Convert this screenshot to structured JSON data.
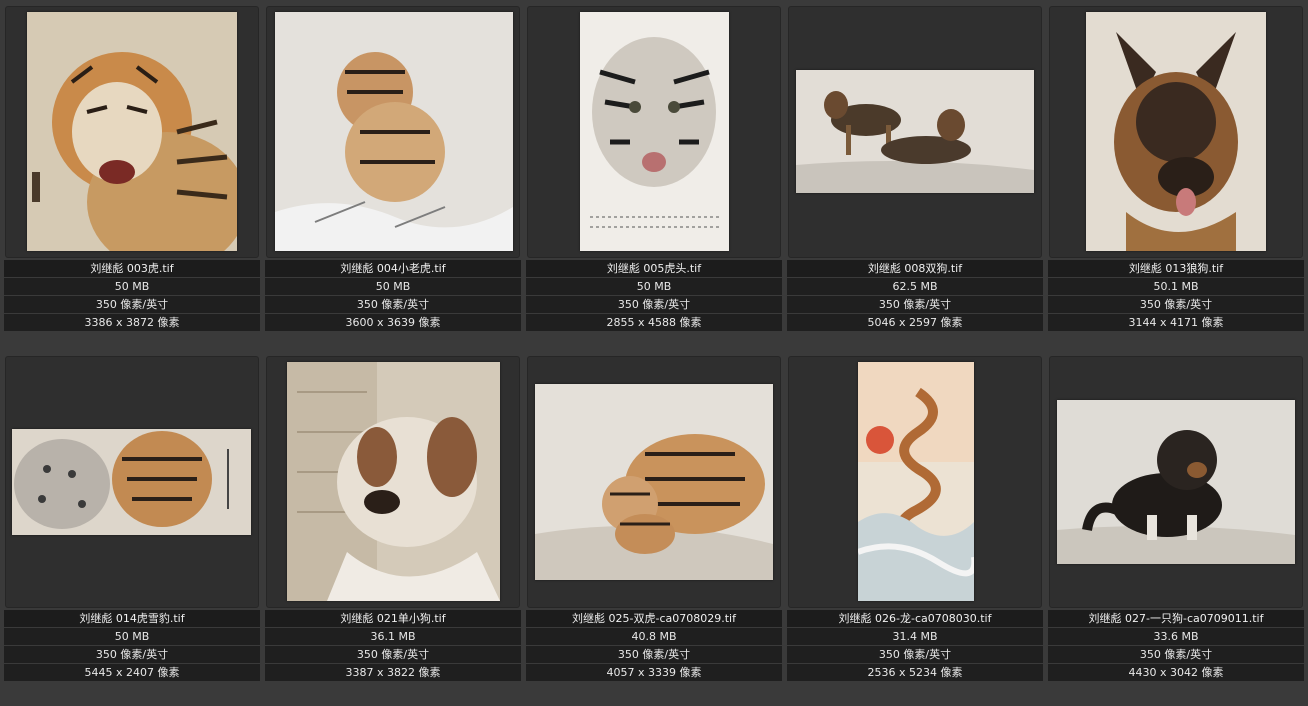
{
  "items": [
    {
      "name": "刘继彪 003虎.tif",
      "size": "50 MB",
      "resolution": "350 像素/英寸",
      "dimensions": "3386 x 3872 像素",
      "subject": "tiger-portrait",
      "bg": "#d9cdb8"
    },
    {
      "name": "刘继彪 004小老虎.tif",
      "size": "50 MB",
      "resolution": "350 像素/英寸",
      "dimensions": "3600 x 3639 像素",
      "subject": "tiger-cub-snow",
      "bg": "#e6e3df"
    },
    {
      "name": "刘继彪 005虎头.tif",
      "size": "50 MB",
      "resolution": "350 像素/英寸",
      "dimensions": "2855 x 4588 像素",
      "subject": "tiger-head",
      "bg": "#efece6"
    },
    {
      "name": "刘继彪 008双狗.tif",
      "size": "62.5 MB",
      "resolution": "350 像素/英寸",
      "dimensions": "5046 x 2597 像素",
      "subject": "two-dogs",
      "bg": "#e0dcd6"
    },
    {
      "name": "刘继彪 013狼狗.tif",
      "size": "50.1 MB",
      "resolution": "350 像素/英寸",
      "dimensions": "3144 x 4171 像素",
      "subject": "shepherd-dog",
      "bg": "#e5ddd2"
    },
    {
      "name": "刘继彪 014虎雪豹.tif",
      "size": "50 MB",
      "resolution": "350 像素/英寸",
      "dimensions": "5445 x 2407 像素",
      "subject": "tiger-snow-leopard",
      "bg": "#ddd6cb"
    },
    {
      "name": "刘继彪 021单小狗.tif",
      "size": "36.1 MB",
      "resolution": "350 像素/英寸",
      "dimensions": "3387 x 3822 像素",
      "subject": "puppy",
      "bg": "#d8cfc1"
    },
    {
      "name": "刘继彪 025-双虎-ca0708029.tif",
      "size": "40.8 MB",
      "resolution": "350 像素/英寸",
      "dimensions": "4057 x 3339 像素",
      "subject": "two-tigers",
      "bg": "#e3dfd8"
    },
    {
      "name": "刘继彪 026-龙-ca0708030.tif",
      "size": "31.4 MB",
      "resolution": "350 像素/英寸",
      "dimensions": "2536 x 5234 像素",
      "subject": "dragon",
      "bg": "#ece2d3"
    },
    {
      "name": "刘继彪 027-一只狗-ca0709011.tif",
      "size": "33.6 MB",
      "resolution": "350 像素/英寸",
      "dimensions": "4430 x 3042 像素",
      "subject": "black-dog",
      "bg": "#dfdcd6"
    }
  ]
}
